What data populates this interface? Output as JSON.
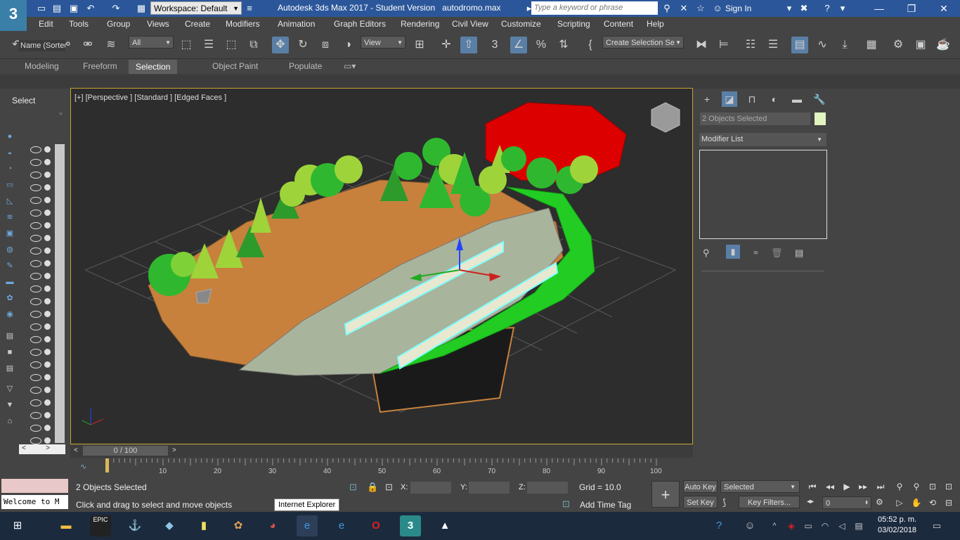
{
  "titlebar": {
    "logo": "3",
    "workspace": "Workspace: Default",
    "app_title": "Autodesk 3ds Max 2017 - Student Version",
    "filename": "autodromo.max",
    "search_placeholder": "Type a keyword or phrase",
    "sign_in": "Sign In"
  },
  "menu": [
    "Edit",
    "Tools",
    "Group",
    "Views",
    "Create",
    "Modifiers",
    "Animation",
    "Graph Editors",
    "Rendering",
    "Civil View",
    "Customize",
    "Scripting",
    "Content",
    "Help"
  ],
  "toolbar": {
    "filter": "All",
    "ref_coord": "View",
    "selection_set": "Create Selection Se"
  },
  "ribbon_tabs": [
    {
      "label": "Modeling",
      "selected": false
    },
    {
      "label": "Freeform",
      "selected": false
    },
    {
      "label": "Selection",
      "selected": true
    },
    {
      "label": "Object Paint",
      "selected": false
    },
    {
      "label": "Populate",
      "selected": false
    }
  ],
  "explorer": {
    "title": "Select",
    "name_header": "Name (Sorted"
  },
  "viewport": {
    "label": "[+] [Perspective ] [Standard ] [Edged Faces ]",
    "colors": {
      "terrain": "#c7813d",
      "road": "#a9b49c",
      "grass": "#22cc22",
      "mountain": "#dd0000",
      "tree_light": "#9ed43a",
      "tree_dark": "#2c9b2c",
      "selection": "#7fffff"
    }
  },
  "command_panel": {
    "selection_name": "2 Objects Selected",
    "modifier_list": "Modifier List"
  },
  "timeline": {
    "frame_display": "0 / 100",
    "ticks": [
      "10",
      "20",
      "30",
      "40",
      "50",
      "60",
      "70",
      "80",
      "90",
      "100"
    ]
  },
  "status": {
    "welcome": "Welcome to M",
    "selected": "2 Objects Selected",
    "prompt": "Click and drag to select and move objects",
    "tooltip": "Internet Explorer",
    "x_label": "X:",
    "y_label": "Y:",
    "z_label": "Z:",
    "grid": "Grid = 10.0",
    "add_time_tag": "Add Time Tag",
    "auto_key": "Auto Key",
    "set_key": "Set Key",
    "key_mode": "Selected",
    "key_filters": "Key Filters...",
    "current_frame": "0"
  },
  "taskbar": {
    "time": "05:52 p. m.",
    "date": "03/02/2018"
  }
}
